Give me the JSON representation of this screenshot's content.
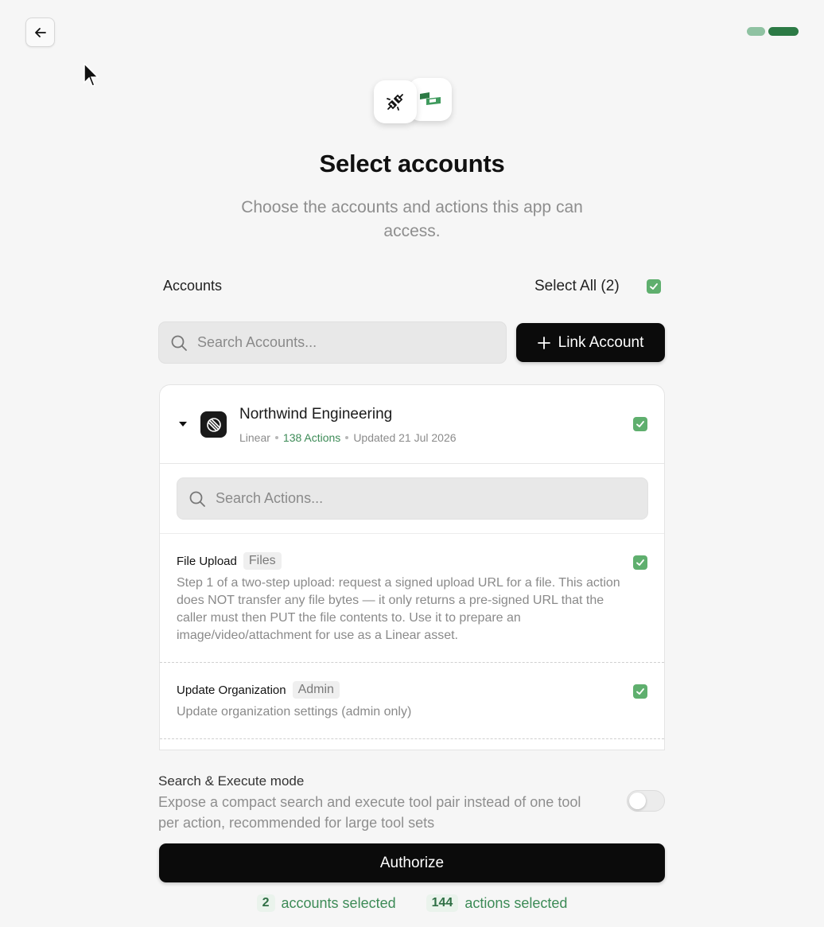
{
  "header": {
    "title": "Select accounts",
    "subtitle": "Choose the accounts and actions this app can access."
  },
  "accounts": {
    "heading": "Accounts",
    "select_all_label": "Select All (2)",
    "search_placeholder": "Search Accounts...",
    "link_button_label": "Link Account"
  },
  "account_card": {
    "name": "Northwind Engineering",
    "provider": "Linear",
    "actions_count": "138 Actions",
    "updated": "Updated 21 Jul 2026",
    "search_placeholder": "Search Actions...",
    "actions": [
      {
        "name": "File Upload",
        "tag": "Files",
        "description": "Step 1 of a two-step upload: request a signed upload URL for a file. This action does NOT transfer any file bytes — it only returns a pre-signed URL that the caller must then PUT the file contents to. Use it to prepare an image/video/attachment for use as a Linear asset."
      },
      {
        "name": "Update Organization",
        "tag": "Admin",
        "description": "Update organization settings (admin only)"
      }
    ]
  },
  "mode": {
    "title": "Search & Execute mode",
    "description": "Expose a compact search and execute tool pair instead of one tool per action, recommended for large tool sets"
  },
  "authorize_label": "Authorize",
  "summary": {
    "accounts_count": "2",
    "accounts_label": "accounts selected",
    "actions_count": "144",
    "actions_label": "actions selected"
  },
  "colors": {
    "accent_green": "#5faf6e",
    "dark_green": "#2c7a45",
    "button_black": "#0b0b0b"
  },
  "icons": [
    "arrow-left-icon",
    "plug-icon",
    "app-logo-icon",
    "search-icon",
    "plus-icon",
    "check-icon",
    "linear-logo-icon",
    "caret-down-icon"
  ]
}
